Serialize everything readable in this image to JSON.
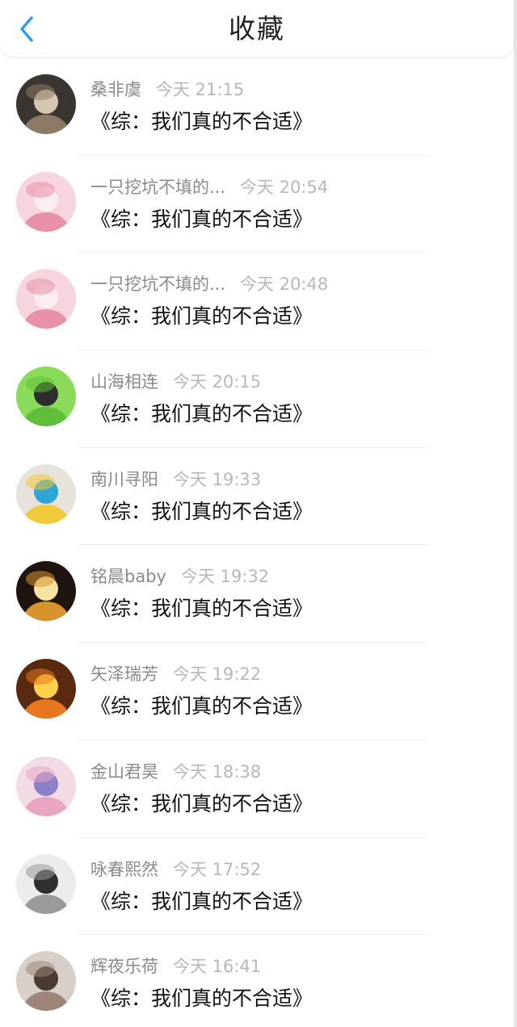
{
  "header": {
    "title": "收藏",
    "back_icon": "chevron-left-icon",
    "accent_color": "#2f9bf0"
  },
  "items": [
    {
      "user": "桑非虞",
      "time": "今天 21:15",
      "title": "《综：我们真的不合适》",
      "avatar_colors": [
        "#3a3530",
        "#8c7a66",
        "#d6c5b0"
      ]
    },
    {
      "user": "一只挖坑不填的...",
      "time": "今天 20:54",
      "title": "《综：我们真的不合适》",
      "avatar_colors": [
        "#f6d5de",
        "#e890a8",
        "#fbeef2"
      ]
    },
    {
      "user": "一只挖坑不填的...",
      "time": "今天 20:48",
      "title": "《综：我们真的不合适》",
      "avatar_colors": [
        "#f6d5de",
        "#e890a8",
        "#fbeef2"
      ]
    },
    {
      "user": "山海相连",
      "time": "今天 20:15",
      "title": "《综：我们真的不合适》",
      "avatar_colors": [
        "#8bdb5a",
        "#5fbf3a",
        "#2d2d2d"
      ]
    },
    {
      "user": "南川寻阳",
      "time": "今天 19:33",
      "title": "《综：我们真的不合适》",
      "avatar_colors": [
        "#e7e2dc",
        "#f1c93a",
        "#2aa7d8"
      ]
    },
    {
      "user": "铭晨baby",
      "time": "今天 19:32",
      "title": "《综：我们真的不合适》",
      "avatar_colors": [
        "#1e1410",
        "#d9932d",
        "#f7e3a0"
      ]
    },
    {
      "user": "矢泽瑞芳",
      "time": "今天 19:22",
      "title": "《综：我们真的不合适》",
      "avatar_colors": [
        "#5a2a10",
        "#e8761e",
        "#ffd24a"
      ]
    },
    {
      "user": "金山君昊",
      "time": "今天 18:38",
      "title": "《综：我们真的不合适》",
      "avatar_colors": [
        "#f3dbe6",
        "#e8a6c3",
        "#8b7fc9"
      ]
    },
    {
      "user": "咏春熙然",
      "time": "今天 17:52",
      "title": "《综：我们真的不合适》",
      "avatar_colors": [
        "#ececec",
        "#9a9a9a",
        "#2f2f2f"
      ]
    },
    {
      "user": "辉夜乐荷",
      "time": "今天 16:41",
      "title": "《综：我们真的不合适》",
      "avatar_colors": [
        "#d9cfc9",
        "#9f8579",
        "#4a3a33"
      ]
    }
  ]
}
